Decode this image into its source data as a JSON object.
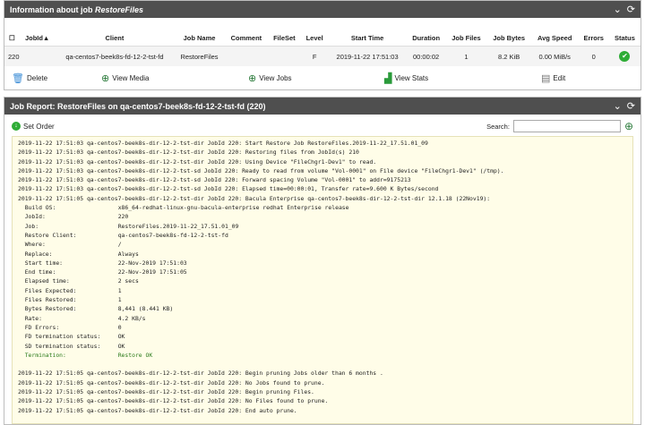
{
  "job_panel": {
    "title_prefix": "Information about job ",
    "title_job": "RestoreFiles",
    "columns": [
      "JobId▲",
      "Client",
      "Job Name",
      "Comment",
      "FileSet",
      "Level",
      "Start Time",
      "Duration",
      "Job Files",
      "Job Bytes",
      "Avg Speed",
      "Errors",
      "Status"
    ],
    "row": [
      "220",
      "qa-centos7-beek8s-fd-12-2-tst-fd",
      "RestoreFiles",
      "",
      "",
      "F",
      "2019-11-22 17:51:03",
      "00:00:02",
      "1",
      "8.2 KiB",
      "0.00 MiB/s",
      "0"
    ],
    "actions": {
      "delete": "Delete",
      "view_media": "View Media",
      "view_jobs": "View Jobs",
      "view_stats": "View Stats",
      "edit": "Edit"
    }
  },
  "report_panel": {
    "title": "Job Report: RestoreFiles on qa-centos7-beek8s-fd-12-2-tst-fd (220)",
    "set_order": "Set Order",
    "search_label": "Search:",
    "search_value": "",
    "log_head": [
      "2019-11-22 17:51:03 qa-centos7-beek8s-dir-12-2-tst-dir JobId 220: Start Restore Job RestoreFiles.2019-11-22_17.51.01_09",
      "2019-11-22 17:51:03 qa-centos7-beek8s-dir-12-2-tst-dir JobId 220: Restoring files from JobId(s) 210",
      "2019-11-22 17:51:03 qa-centos7-beek8s-dir-12-2-tst-dir JobId 220: Using Device \"FileChgr1-Dev1\" to read.",
      "2019-11-22 17:51:03 qa-centos7-beek8s-dir-12-2-tst-sd JobId 220: Ready to read from volume \"Vol-0001\" on File device \"FileChgr1-Dev1\" (/tmp).",
      "2019-11-22 17:51:03 qa-centos7-beek8s-dir-12-2-tst-sd JobId 220: Forward spacing Volume \"Vol-0001\" to addr=9175213",
      "2019-11-22 17:51:03 qa-centos7-beek8s-dir-12-2-tst-sd JobId 220: Elapsed time=00:00:01, Transfer rate=9.600 K Bytes/second",
      "2019-11-22 17:51:05 qa-centos7-beek8s-dir-12-2-tst-dir JobId 220: Bacula Enterprise qa-centos7-beek8s-dir-12-2-tst-dir 12.1.18 (22Nov19):"
    ],
    "summary": [
      {
        "k": "Build OS:",
        "v": "x86_64-redhat-linux-gnu-bacula-enterprise redhat Enterprise release"
      },
      {
        "k": "JobId:",
        "v": "220"
      },
      {
        "k": "Job:",
        "v": "RestoreFiles.2019-11-22_17.51.01_09"
      },
      {
        "k": "Restore Client:",
        "v": "qa-centos7-beek8s-fd-12-2-tst-fd"
      },
      {
        "k": "Where:",
        "v": "/"
      },
      {
        "k": "Replace:",
        "v": "Always"
      },
      {
        "k": "Start time:",
        "v": "22-Nov-2019 17:51:03"
      },
      {
        "k": "End time:",
        "v": "22-Nov-2019 17:51:05"
      },
      {
        "k": "Elapsed time:",
        "v": "2 secs"
      },
      {
        "k": "Files Expected:",
        "v": "1"
      },
      {
        "k": "Files Restored:",
        "v": "1"
      },
      {
        "k": "Bytes Restored:",
        "v": "8,441 (8.441 KB)"
      },
      {
        "k": "Rate:",
        "v": "4.2 KB/s"
      },
      {
        "k": "FD Errors:",
        "v": "0"
      },
      {
        "k": "FD termination status:",
        "v": "OK"
      },
      {
        "k": "SD termination status:",
        "v": "OK"
      },
      {
        "k": "Termination:",
        "v": "Restore OK"
      }
    ],
    "log_tail": [
      "2019-11-22 17:51:05 qa-centos7-beek8s-dir-12-2-tst-dir JobId 220: Begin pruning Jobs older than 6 months .",
      "2019-11-22 17:51:05 qa-centos7-beek8s-dir-12-2-tst-dir JobId 220: No Jobs found to prune.",
      "2019-11-22 17:51:05 qa-centos7-beek8s-dir-12-2-tst-dir JobId 220: Begin pruning Files.",
      "2019-11-22 17:51:05 qa-centos7-beek8s-dir-12-2-tst-dir JobId 220: No Files found to prune.",
      "2019-11-22 17:51:05 qa-centos7-beek8s-dir-12-2-tst-dir JobId 220: End auto prune."
    ]
  }
}
